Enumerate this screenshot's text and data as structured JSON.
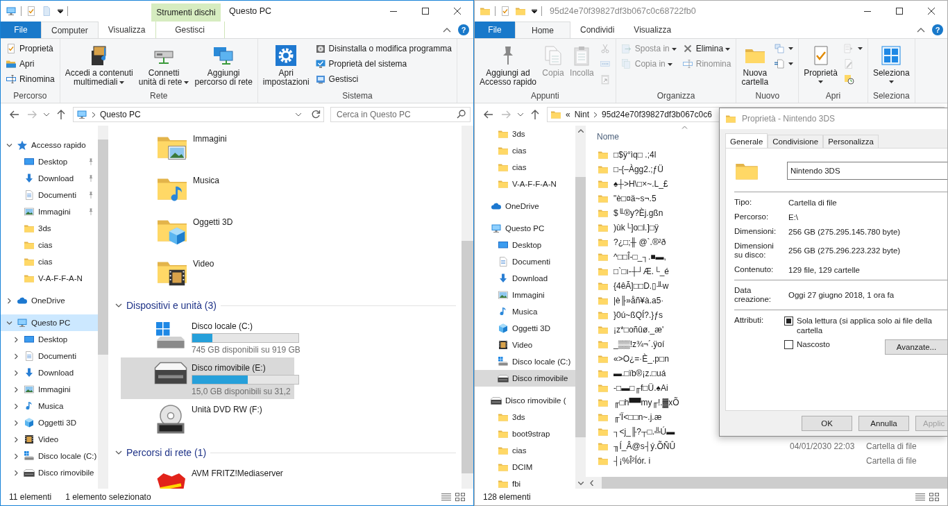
{
  "left_window": {
    "active": true,
    "title": "Questo PC",
    "context_label": "Strumenti dischi",
    "help": "?",
    "tabs": [
      {
        "label": "File",
        "kind": "file",
        "selected": false
      },
      {
        "label": "Computer",
        "kind": "tab",
        "selected": true
      },
      {
        "label": "Visualizza",
        "kind": "tab",
        "selected": false
      },
      {
        "label": "Gestisci",
        "kind": "context",
        "selected": false
      }
    ],
    "ribbon_groups": [
      {
        "label": "Percorso",
        "columns": [
          [
            {
              "kind": "small",
              "label": "Proprietà",
              "dropdown": false
            },
            {
              "kind": "small",
              "label": "Apri",
              "dropdown": false
            },
            {
              "kind": "small",
              "label": "Rinomina",
              "dropdown": false
            }
          ]
        ]
      },
      {
        "label": "Rete",
        "columns": [
          [
            {
              "kind": "large",
              "label": "Accedi a contenuti\nmultimediali",
              "dropdown": true
            }
          ],
          [
            {
              "kind": "large",
              "label": "Connetti\nunità di rete",
              "dropdown": true
            }
          ],
          [
            {
              "kind": "large",
              "label": "Aggiungi\npercorso di rete",
              "dropdown": false
            }
          ]
        ]
      },
      {
        "label": "Sistema",
        "columns": [
          [
            {
              "kind": "large",
              "label": "Apri\nimpostazioni",
              "dropdown": false
            }
          ],
          [
            {
              "kind": "small",
              "label": "Disinstalla o modifica programma",
              "dropdown": false
            },
            {
              "kind": "small",
              "label": "Proprietà del sistema",
              "dropdown": false
            },
            {
              "kind": "small",
              "label": "Gestisci",
              "dropdown": false
            }
          ]
        ]
      }
    ],
    "address": {
      "path": [
        "Questo PC"
      ],
      "search_placeholder": "Cerca in Questo PC"
    },
    "nav": {
      "items": [
        {
          "label": "Accesso rapido",
          "kind": "star",
          "expanded": true,
          "selected": false,
          "children": [
            {
              "label": "Desktop",
              "kind": "desktop",
              "pinned": true,
              "selected": false
            },
            {
              "label": "Download",
              "kind": "download",
              "pinned": true,
              "selected": false
            },
            {
              "label": "Documenti",
              "kind": "document",
              "pinned": true,
              "selected": false
            },
            {
              "label": "Immagini",
              "kind": "picture",
              "pinned": true,
              "selected": false
            },
            {
              "label": "3ds",
              "kind": "folder",
              "pinned": false,
              "selected": false
            },
            {
              "label": "cias",
              "kind": "folder",
              "pinned": false,
              "selected": false
            },
            {
              "label": "cias",
              "kind": "folder",
              "pinned": false,
              "selected": false
            },
            {
              "label": "V-A-F-F-A-N",
              "kind": "folder",
              "pinned": false,
              "selected": false
            }
          ]
        },
        {
          "label": "OneDrive",
          "kind": "onedrive",
          "expanded": false,
          "selected": false
        },
        {
          "label": "Questo PC",
          "kind": "pc",
          "expanded": true,
          "selected": true,
          "children": [
            {
              "label": "Desktop",
              "kind": "desktop",
              "expanded": false,
              "selected": false
            },
            {
              "label": "Documenti",
              "kind": "document",
              "expanded": false,
              "selected": false
            },
            {
              "label": "Download",
              "kind": "download",
              "expanded": false,
              "selected": false
            },
            {
              "label": "Immagini",
              "kind": "picture",
              "expanded": false,
              "selected": false
            },
            {
              "label": "Musica",
              "kind": "music",
              "expanded": false,
              "selected": false
            },
            {
              "label": "Oggetti 3D",
              "kind": "cube",
              "expanded": false,
              "selected": false
            },
            {
              "label": "Video",
              "kind": "video",
              "expanded": false,
              "selected": false
            },
            {
              "label": "Disco locale (C:)",
              "kind": "drivec",
              "expanded": false,
              "selected": false
            },
            {
              "label": "Disco rimovibile",
              "kind": "usb",
              "expanded": false,
              "selected": false
            }
          ]
        }
      ]
    },
    "content": {
      "folders": [
        {
          "label": "Immagini",
          "kind": "picture"
        },
        {
          "label": "Musica",
          "kind": "music"
        },
        {
          "label": "Oggetti 3D",
          "kind": "cube"
        },
        {
          "label": "Video",
          "kind": "video"
        }
      ],
      "groups": [
        {
          "title": "Dispositivi e unità (3)",
          "items": [
            {
              "label": "Disco locale (C:)",
              "kind": "drivec",
              "level": 0.19,
              "free": "745 GB disponibili su 919 GB",
              "selected": false
            },
            {
              "label": "Disco rimovibile (E:)",
              "kind": "usb",
              "level": 0.52,
              "free": "15,0 GB disponibili su 31,2",
              "selected": true
            },
            {
              "label": "Unità DVD RW (F:)",
              "kind": "dvd",
              "selected": false
            }
          ]
        },
        {
          "title": "Percorsi di rete (1)",
          "items": [
            {
              "label": "AVM FRITZ!Mediaserver",
              "kind": "fritz",
              "selected": false
            }
          ]
        }
      ]
    },
    "status": {
      "count": "11 elementi",
      "selection": "1 elemento selezionato"
    }
  },
  "right_window": {
    "active": false,
    "title": "95d24e70f39827df3b067c0c68722fb0",
    "help": "?",
    "tabs": [
      {
        "label": "File",
        "kind": "file",
        "selected": false
      },
      {
        "label": "Home",
        "kind": "tab",
        "selected": true
      },
      {
        "label": "Condividi",
        "kind": "tab",
        "selected": false
      },
      {
        "label": "Visualizza",
        "kind": "tab",
        "selected": false
      }
    ],
    "ribbon_groups": [
      {
        "label": "Appunti",
        "columns": [
          [
            {
              "kind": "large",
              "label": "Aggiungi ad\nAccesso rapido",
              "dropdown": false,
              "disabled": false
            }
          ],
          [
            {
              "kind": "large",
              "label": "Copia",
              "dropdown": false,
              "disabled": true
            }
          ],
          [
            {
              "kind": "large",
              "label": "Incolla",
              "dropdown": false,
              "disabled": true
            }
          ],
          [
            {
              "kind": "icon",
              "dropdown": false,
              "disabled": true
            },
            {
              "kind": "icon",
              "dropdown": false,
              "disabled": true
            },
            {
              "kind": "icon",
              "dropdown": false,
              "disabled": true
            }
          ]
        ]
      },
      {
        "label": "Organizza",
        "columns": [
          [
            {
              "kind": "small",
              "label": "Sposta in",
              "dropdown": true,
              "disabled": true
            },
            {
              "kind": "small",
              "label": "Copia in",
              "dropdown": true,
              "disabled": true
            }
          ],
          [
            {
              "kind": "small",
              "label": "Elimina",
              "dropdown": true,
              "disabled": false
            },
            {
              "kind": "small",
              "label": "Rinomina",
              "dropdown": false,
              "disabled": true
            }
          ]
        ]
      },
      {
        "label": "Nuovo",
        "columns": [
          [
            {
              "kind": "large",
              "label": "Nuova\ncartella",
              "dropdown": false,
              "disabled": false
            }
          ],
          [
            {
              "kind": "icon",
              "dropdown": true,
              "disabled": false
            },
            {
              "kind": "icon",
              "dropdown": true,
              "disabled": false
            }
          ]
        ]
      },
      {
        "label": "Apri",
        "columns": [
          [
            {
              "kind": "large",
              "label": "Proprietà",
              "dropdown": true,
              "disabled": false
            }
          ],
          [
            {
              "kind": "icon",
              "dropdown": true,
              "disabled": true
            },
            {
              "kind": "icon",
              "dropdown": false,
              "disabled": true
            },
            {
              "kind": "icon",
              "dropdown": false,
              "disabled": false
            }
          ]
        ]
      },
      {
        "label": "Seleziona",
        "columns": [
          [
            {
              "kind": "large",
              "label": "Seleziona",
              "dropdown": true,
              "disabled": false
            }
          ]
        ]
      }
    ],
    "address": {
      "overflow": "«",
      "path": [
        "Nint",
        "95d24e70f39827df3b067c0c6"
      ]
    },
    "nav": {
      "quick_access_items": [
        {
          "label": "3ds",
          "kind": "folder",
          "selected": false
        },
        {
          "label": "cias",
          "kind": "folder",
          "selected": false
        },
        {
          "label": "cias",
          "kind": "folder",
          "selected": false
        },
        {
          "label": "V-A-F-F-A-N",
          "kind": "folder",
          "selected": false
        }
      ],
      "items": [
        {
          "label": "OneDrive",
          "kind": "onedrive",
          "selected": false
        },
        {
          "label": "Questo PC",
          "kind": "pc",
          "selected": false,
          "children": [
            {
              "label": "Desktop",
              "kind": "desktop",
              "selected": false
            },
            {
              "label": "Documenti",
              "kind": "document",
              "selected": false
            },
            {
              "label": "Download",
              "kind": "download",
              "selected": false
            },
            {
              "label": "Immagini",
              "kind": "picture",
              "selected": false
            },
            {
              "label": "Musica",
              "kind": "music",
              "selected": false
            },
            {
              "label": "Oggetti 3D",
              "kind": "cube",
              "selected": false
            },
            {
              "label": "Video",
              "kind": "video",
              "selected": false
            },
            {
              "label": "Disco locale (C:)",
              "kind": "drivec",
              "selected": false
            },
            {
              "label": "Disco rimovibile",
              "kind": "usb",
              "selected": true
            }
          ]
        },
        {
          "label": "Disco rimovibile (",
          "kind": "usb",
          "selected": false,
          "children": [
            {
              "label": "3ds",
              "kind": "folder",
              "selected": false
            },
            {
              "label": "boot9strap",
              "kind": "folder",
              "selected": false
            },
            {
              "label": "cias",
              "kind": "folder",
              "selected": false
            },
            {
              "label": "DCIM",
              "kind": "folder",
              "selected": false
            },
            {
              "label": "fbi",
              "kind": "folder",
              "selected": false
            }
          ]
        }
      ]
    },
    "files": {
      "name_header": "Nome",
      "rows": [
        {
          "name": "□$ÿ°ìq□  .;4l"
        },
        {
          "name": "□-{–Àgg2.;ƒÜ"
        },
        {
          "name": "♠┼>H\\□×~.L_£"
        },
        {
          "name": "\"è□¤ä~s¬.5"
        },
        {
          "name": "$╙®y?Èj.gßn"
        },
        {
          "name": ")ùk└]o□l.]□ÿ"
        },
        {
          "name": "?¿□;╫ @`.®²ð"
        },
        {
          "name": "^□□Î-□_┐.■▬,"
        },
        {
          "name": "□`□ı-┼┘Æ.└_é"
        },
        {
          "name": "{4êÃ]□□D.▯╨w"
        },
        {
          "name": "|è╟»åñ¥à.a5·"
        },
        {
          "name": "}0ú~ßQÍ?.}ƒs"
        },
        {
          "name": "¡z*□oñûø._æ'"
        },
        {
          "name": "_▒▒!z¾¬´.ÿoí"
        },
        {
          "name": "«>O¿=·È_.p□n"
        },
        {
          "name": "▬.□ïb®¡z.□uá"
        },
        {
          "name": "-□▬□╓f□Ü.♠Ai"
        },
        {
          "name": "╓□h▀▀my╓!.▓xÕ"
        },
        {
          "name": "╓'Ï<□□n~.j.æ"
        },
        {
          "name": "┐<j_╟?┬□.╩Ú▬"
        },
        {
          "name": "╖Í_Â@s┤ý.ÕÑÛ",
          "date": "04/01/2030 22:03",
          "type": "Cartella di file"
        },
        {
          "name": "┤¡%Î²Íór. i",
          "type": "Cartella di file"
        }
      ]
    },
    "dialog": {
      "title": "Proprietà - Nintendo 3DS",
      "tabs": [
        {
          "label": "Generale",
          "selected": true
        },
        {
          "label": "Condivisione",
          "selected": false
        },
        {
          "label": "Personalizza",
          "selected": false
        }
      ],
      "name": "Nintendo 3DS",
      "sections": [
        [
          {
            "label": "Tipo:",
            "value": "Cartella di file"
          },
          {
            "label": "Percorso:",
            "value": "E:\\"
          },
          {
            "label": "Dimensioni:",
            "value": "256 GB (275.295.145.780 byte)"
          },
          {
            "label": "Dimensioni\nsu disco:",
            "value": "256 GB (275.296.223.232 byte)"
          },
          {
            "label": "Contenuto:",
            "value": "129 file, 129 cartelle"
          }
        ],
        [
          {
            "label": "Data\ncreazione:",
            "value": "Oggi 27 giugno 2018, 1 ora fa"
          }
        ]
      ],
      "attributes_label": "Attributi:",
      "attributes": [
        {
          "label": "Sola lettura (si applica solo ai file della cartella",
          "checked": true
        },
        {
          "label": "Nascosto",
          "checked": false
        }
      ],
      "advanced_button": "Avanzate...",
      "buttons": [
        {
          "label": "OK",
          "disabled": false
        },
        {
          "label": "Annulla",
          "disabled": false
        },
        {
          "label": "Applic",
          "disabled": true
        }
      ]
    },
    "status": {
      "count": "128 elementi"
    }
  }
}
